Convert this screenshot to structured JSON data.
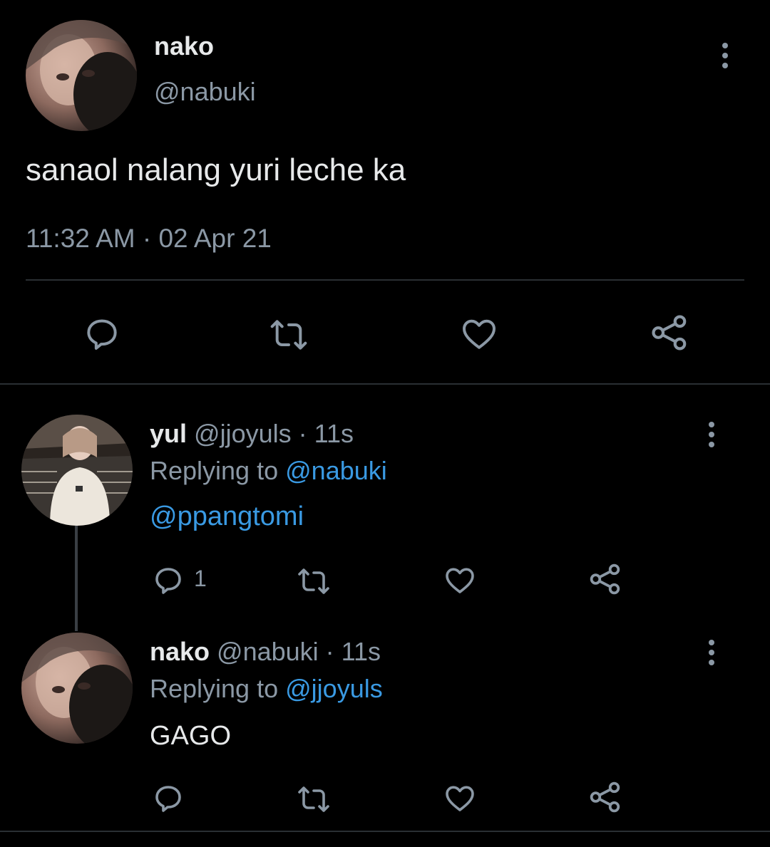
{
  "main_tweet": {
    "display_name": "nako",
    "handle": "@nabuki",
    "text": "sanaol nalang yuri leche ka",
    "timestamp": "11:32 AM · 02 Apr 21",
    "avatar_icon": "avatar-photo"
  },
  "replies": [
    {
      "display_name": "yul",
      "handle_time": "@jjoyuls · 11s",
      "replying_prefix": "Replying to",
      "replying_to": "@nabuki",
      "text": "@ppangtomi",
      "reply_count": "1",
      "avatar_icon": "avatar-photo"
    },
    {
      "display_name": "nako",
      "handle_time": "@nabuki · 11s",
      "replying_prefix": "Replying to",
      "replying_to": "@jjoyuls",
      "text": "GAGO",
      "reply_count": "",
      "avatar_icon": "avatar-photo"
    }
  ],
  "colors": {
    "background": "#000000",
    "text": "#e7e9ea",
    "secondary": "#8b98a5",
    "link": "#3a9ae3",
    "divider": "#2a2f33"
  },
  "icons": [
    "reply-icon",
    "retweet-icon",
    "like-icon",
    "share-icon",
    "more-icon"
  ]
}
